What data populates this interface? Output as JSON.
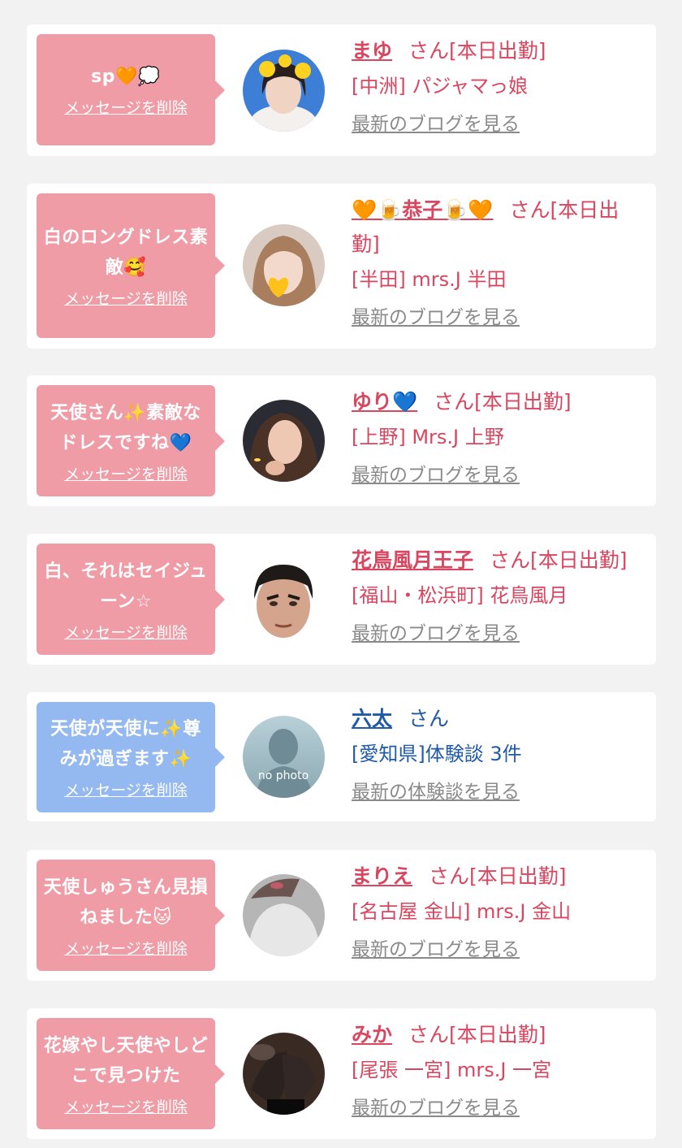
{
  "items": [
    {
      "message": "sp🧡💭",
      "delete": "メッセージを削除",
      "name": "まゆ",
      "suffix": "さん[本日出勤]",
      "shop": "[中洲] パジャマっ娘",
      "blog": "最新のブログを見る",
      "avatar": "photo-avatar-girl-duck-filter",
      "bubble_color": "#ef9ca6"
    },
    {
      "message": "白のロングドレス素敵🥰",
      "delete": "メッセージを削除",
      "name": "🧡🍺恭子🍺🧡",
      "suffix": "さん[本日出勤]",
      "shop": "[半田] mrs.J 半田",
      "blog": "最新のブログを見る",
      "avatar": "photo-avatar-girl-heart",
      "bubble_color": "#ef9ca6"
    },
    {
      "message": "天使さん✨素敵なドレスですね💙",
      "delete": "メッセージを削除",
      "name": "ゆり💙",
      "suffix": "さん[本日出勤]",
      "shop": "[上野] Mrs.J 上野",
      "blog": "最新のブログを見る",
      "avatar": "photo-avatar-girl-smile",
      "bubble_color": "#ef9ca6"
    },
    {
      "message": "白、それはセイジューン☆",
      "delete": "メッセージを削除",
      "name": "花鳥風月王子",
      "suffix": "さん[本日出勤]",
      "shop": "[福山・松浜町] 花鳥風月",
      "blog": "最新のブログを見る",
      "avatar": "photo-avatar-man-face",
      "bubble_color": "#ef9ca6"
    },
    {
      "message": "天使が天使に✨尊みが過ぎます✨",
      "delete": "メッセージを削除",
      "name": "六太",
      "suffix": "さん",
      "shop": "[愛知県]体験談 3件",
      "blog": "最新の体験談を見る",
      "avatar": "no-photo-avatar",
      "no_photo_label": "no photo",
      "bubble_color": "#94b8f0"
    },
    {
      "message": "天使しゅうさん見損ねました🐱",
      "delete": "メッセージを削除",
      "name": "まりえ",
      "suffix": "さん[本日出勤]",
      "shop": "[名古屋 金山] mrs.J 金山",
      "blog": "最新のブログを見る",
      "avatar": "photo-avatar-girl-white",
      "bubble_color": "#ef9ca6"
    },
    {
      "message": "花嫁やし天使やしどこで見つけた",
      "delete": "メッセージを削除",
      "name": "みか",
      "suffix": "さん[本日出勤]",
      "shop": "[尾張 一宮] mrs.J 一宮",
      "blog": "最新のブログを見る",
      "avatar": "photo-avatar-legs",
      "bubble_color": "#ef9ca6"
    }
  ]
}
